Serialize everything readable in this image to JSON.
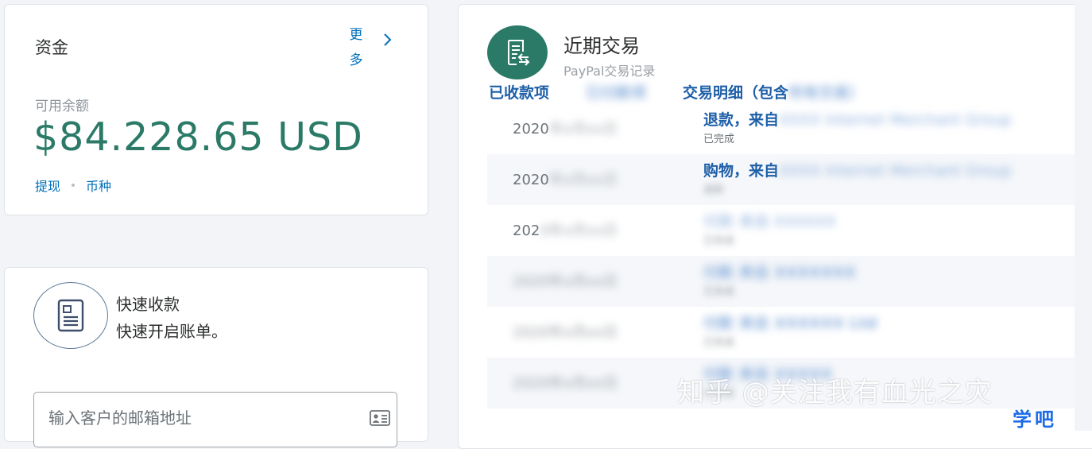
{
  "funds": {
    "title": "资金",
    "more": "更多",
    "available_label": "可用余额",
    "balance": "$84.228.65 USD",
    "withdraw": "提现",
    "currency": "币种"
  },
  "quick_collect": {
    "title": "快速收款",
    "description": "快速开启账单。",
    "email_placeholder": "输入客户的邮箱地址",
    "icon": "invoice-icon",
    "field_icon": "contact-card-icon"
  },
  "transactions": {
    "title": "近期交易",
    "subtitle": "PayPal交易记录",
    "icon": "document-arrow-icon",
    "tabs": {
      "received": "已收款项",
      "second": "已付款项",
      "details_visible": "交易明细（包含",
      "details_blurred": "所有交易）"
    },
    "rows": [
      {
        "date": "2020",
        "date_blur": "年x月xx日",
        "desc": "退款，来自",
        "desc_blur": "XXXX Internet Merchant Group",
        "status": "已完成"
      },
      {
        "date": "2020",
        "date_blur": "年x月xx日",
        "desc": "购物，来自",
        "desc_blur": "XXXX Internet Merchant Group",
        "status": "退款"
      },
      {
        "date": "202",
        "date_blur": "0年x月xx日",
        "desc": "付款",
        "desc_blur": "来自 XXXXXX",
        "status": "已完成"
      },
      {
        "date": "2020年x月xx日",
        "desc": "付款 来自 XXXXXXX",
        "status": "已完成"
      },
      {
        "date": "2020年x月xx日",
        "desc": "付款 来自 XXXXXX Ltd",
        "status": "已完成"
      },
      {
        "date": "2020年x月xx日",
        "desc": "付款 来自 XXXXX",
        "status": "已完成"
      }
    ]
  },
  "watermark": {
    "main": "知乎 @关注我有血光之灾",
    "small": "学吧"
  },
  "colors": {
    "accent_green": "#2b7a67",
    "link_blue": "#0070ba",
    "tab_blue": "#1e5fa8"
  }
}
